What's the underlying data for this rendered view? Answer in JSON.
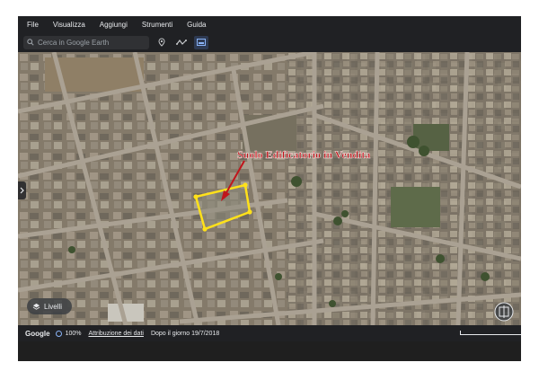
{
  "menu": {
    "items": [
      "File",
      "Visualizza",
      "Aggiungi",
      "Strumenti",
      "Guida"
    ]
  },
  "toolbar": {
    "search_placeholder": "Cerca in Google Earth",
    "icons": [
      "search-icon",
      "placemark-icon",
      "path-icon",
      "image-overlay-icon"
    ]
  },
  "map": {
    "annotation_text": "Suolo Edificatorio in Vendita",
    "annotation_color": "#c0151b",
    "polygon_color": "#ffe11a"
  },
  "controls": {
    "layers_label": "Livelli"
  },
  "status": {
    "brand": "Google",
    "zoom": "100%",
    "attribution": "Attribuzione dei dati",
    "imagery_date": "Dopo il giorno 19/7/2018"
  }
}
